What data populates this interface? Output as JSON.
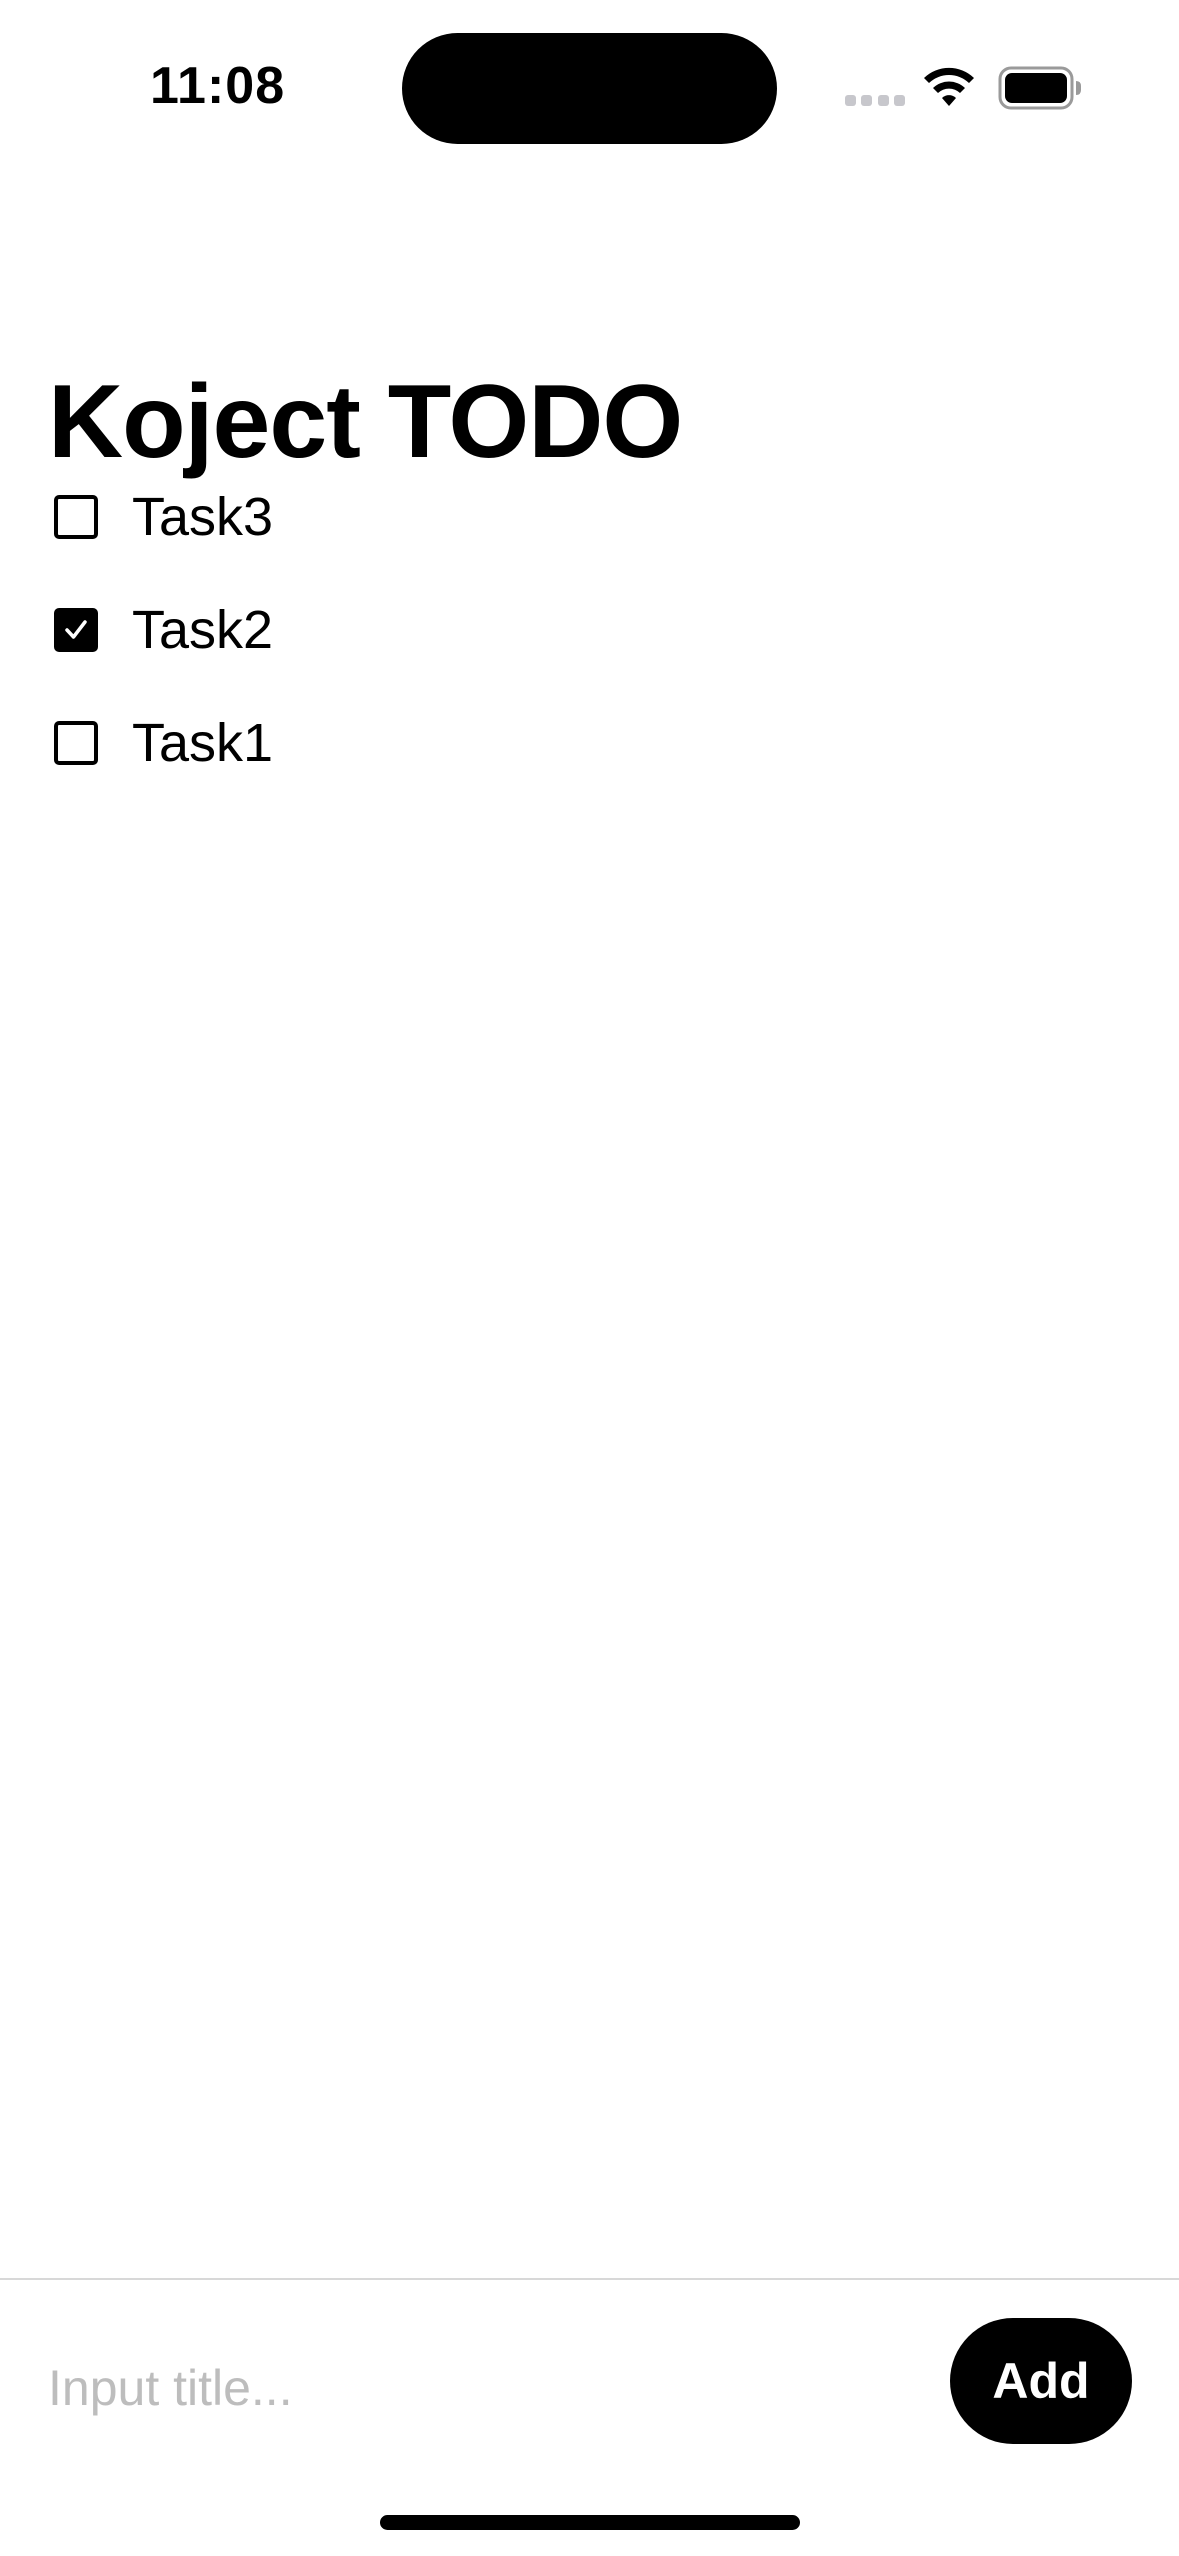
{
  "status_bar": {
    "time": "11:08",
    "icons": [
      "signal-icon",
      "wifi-icon",
      "battery-icon"
    ]
  },
  "header": {
    "title": "Koject TODO"
  },
  "tasks": [
    {
      "label": "Task3",
      "checked": false
    },
    {
      "label": "Task2",
      "checked": true
    },
    {
      "label": "Task1",
      "checked": false
    }
  ],
  "input_bar": {
    "placeholder": "Input title...",
    "value": "",
    "add_label": "Add"
  },
  "colors": {
    "background": "#ffffff",
    "text": "#000000",
    "accent": "#000000",
    "placeholder": "#bdbdbd",
    "divider": "#d8d8d8"
  }
}
